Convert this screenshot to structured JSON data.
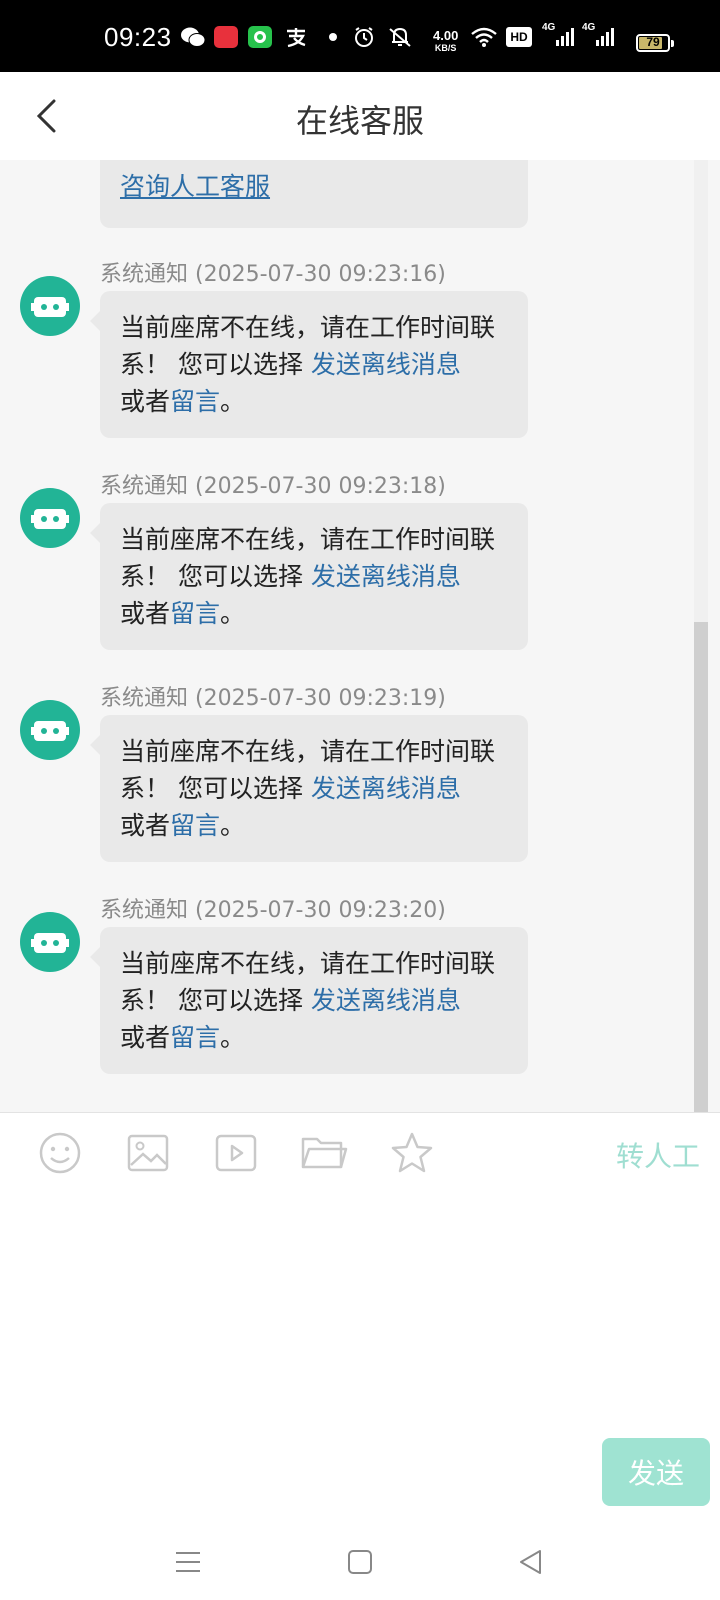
{
  "status_bar": {
    "time": "09:23",
    "speed_value": "4.00",
    "speed_unit": "KB/S",
    "hd_label": "HD",
    "net1": "4G",
    "net2": "4G",
    "battery": "79",
    "icons": [
      "wechat-icon",
      "app-icon",
      "green-app-icon",
      "alipay-icon",
      "dot-icon",
      "alarm-icon",
      "mute-icon",
      "wifi-icon",
      "signal-icon",
      "signal-icon",
      "battery-icon"
    ]
  },
  "header": {
    "title": "在线客服"
  },
  "chat": {
    "top_partial_link": "咨询人工客服",
    "messages": [
      {
        "sender": "系统通知",
        "time": "(2025-07-30 09:23:16)",
        "text_1": "当前座席不在线，请在工作时间联系！ 您可以选择 ",
        "link_1": "发送离线消息",
        "text_2": "或者",
        "link_2": "留言",
        "text_3": "。"
      },
      {
        "sender": "系统通知",
        "time": "(2025-07-30 09:23:18)",
        "text_1": "当前座席不在线，请在工作时间联系！ 您可以选择 ",
        "link_1": "发送离线消息",
        "text_2": "或者",
        "link_2": "留言",
        "text_3": "。"
      },
      {
        "sender": "系统通知",
        "time": "(2025-07-30 09:23:19)",
        "text_1": "当前座席不在线，请在工作时间联系！ 您可以选择 ",
        "link_1": "发送离线消息",
        "text_2": "或者",
        "link_2": "留言",
        "text_3": "。"
      },
      {
        "sender": "系统通知",
        "time": "(2025-07-30 09:23:20)",
        "text_1": "当前座席不在线，请在工作时间联系！ 您可以选择 ",
        "link_1": "发送离线消息",
        "text_2": "或者",
        "link_2": "留言",
        "text_3": "。"
      }
    ]
  },
  "toolbar": {
    "icons": [
      "emoji-icon",
      "image-icon",
      "video-icon",
      "folder-icon",
      "star-icon"
    ],
    "transfer_label": "转人工"
  },
  "send_label": "发送",
  "colors": {
    "accent": "#22b496",
    "link": "#2d6ea8",
    "send_disabled": "#9fe3d2",
    "bubble": "#e9e9e9"
  }
}
